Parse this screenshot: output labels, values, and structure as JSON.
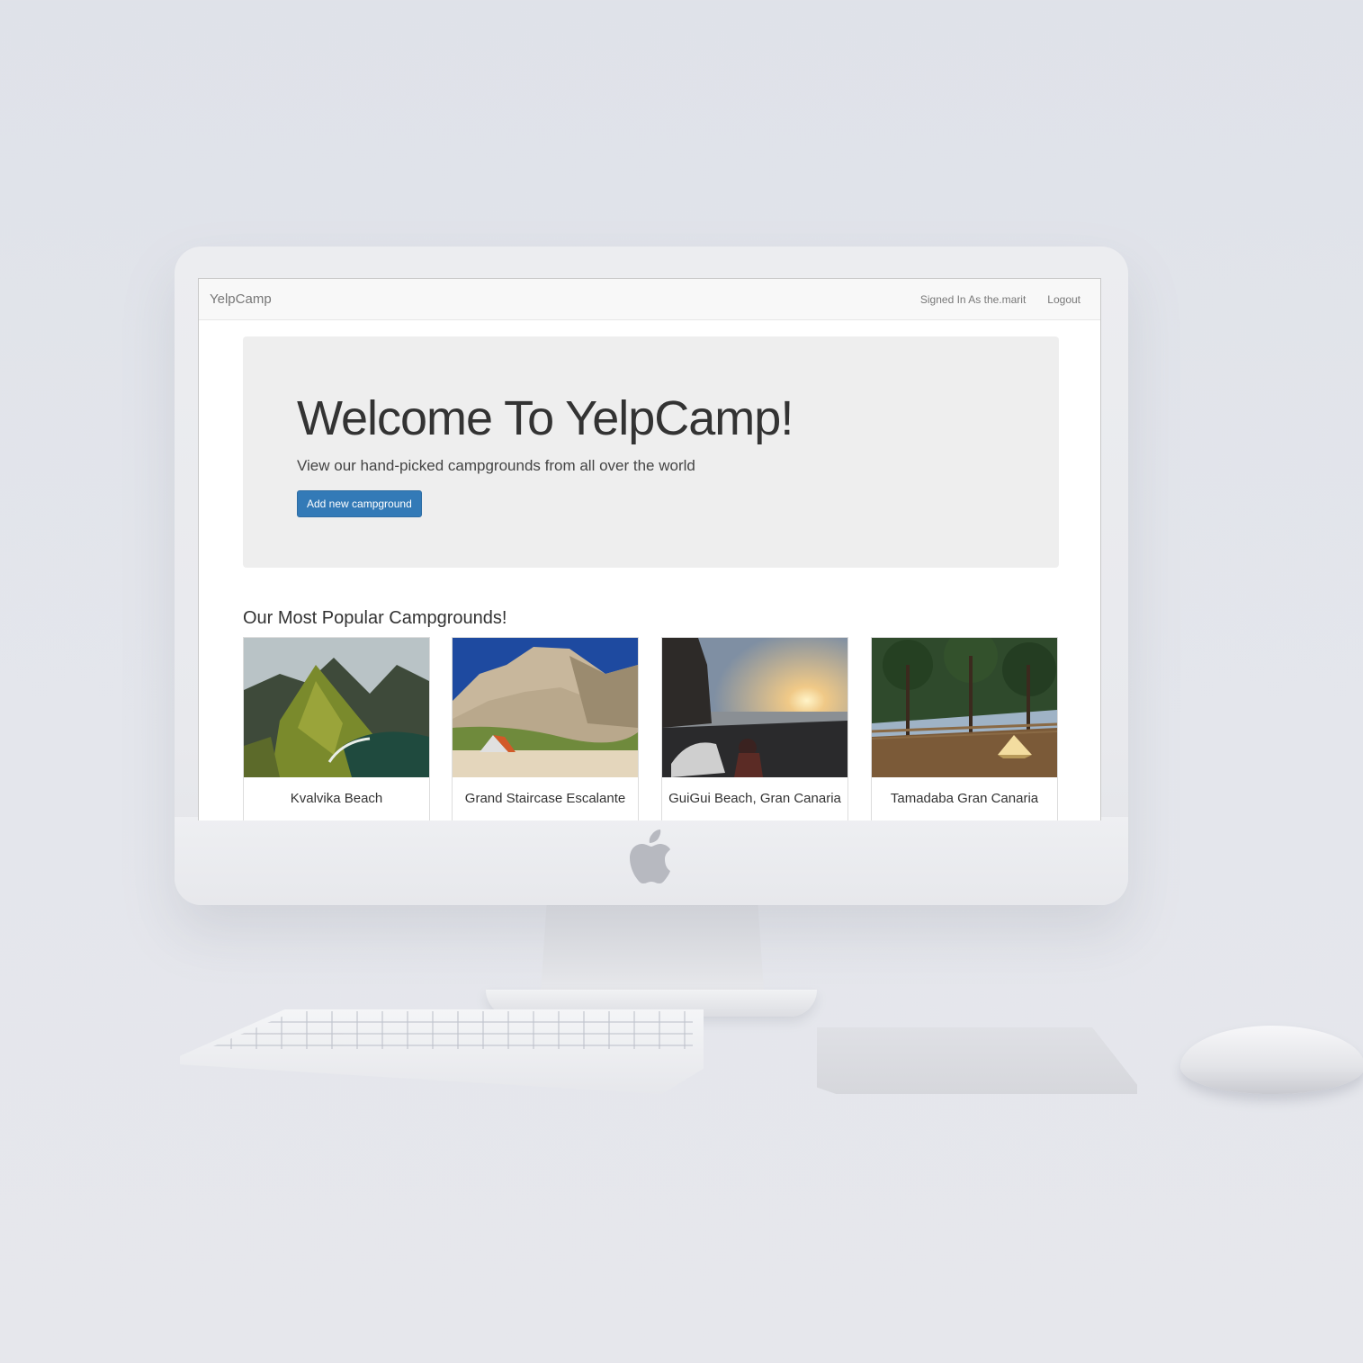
{
  "navbar": {
    "brand": "YelpCamp",
    "signed_in_text": "Signed In As the.marit",
    "logout_label": "Logout"
  },
  "hero": {
    "title": "Welcome To YelpCamp!",
    "subtitle": "View our hand-picked campgrounds from all over the world",
    "button_label": "Add new campground"
  },
  "popular": {
    "heading": "Our Most Popular Campgrounds!",
    "cards": [
      {
        "title": "Kvalvika Beach",
        "image": "mountain-coast-photo"
      },
      {
        "title": "Grand Staircase Escalante",
        "image": "desert-tent-photo"
      },
      {
        "title": "GuiGui Beach, Gran Canaria",
        "image": "sunset-beach-photo"
      },
      {
        "title": "Tamadaba Gran Canaria",
        "image": "forest-tent-photo"
      }
    ]
  },
  "colors": {
    "primary_button": "#337ab7",
    "jumbotron_bg": "#eeeeee",
    "navbar_bg": "#f8f8f8"
  }
}
